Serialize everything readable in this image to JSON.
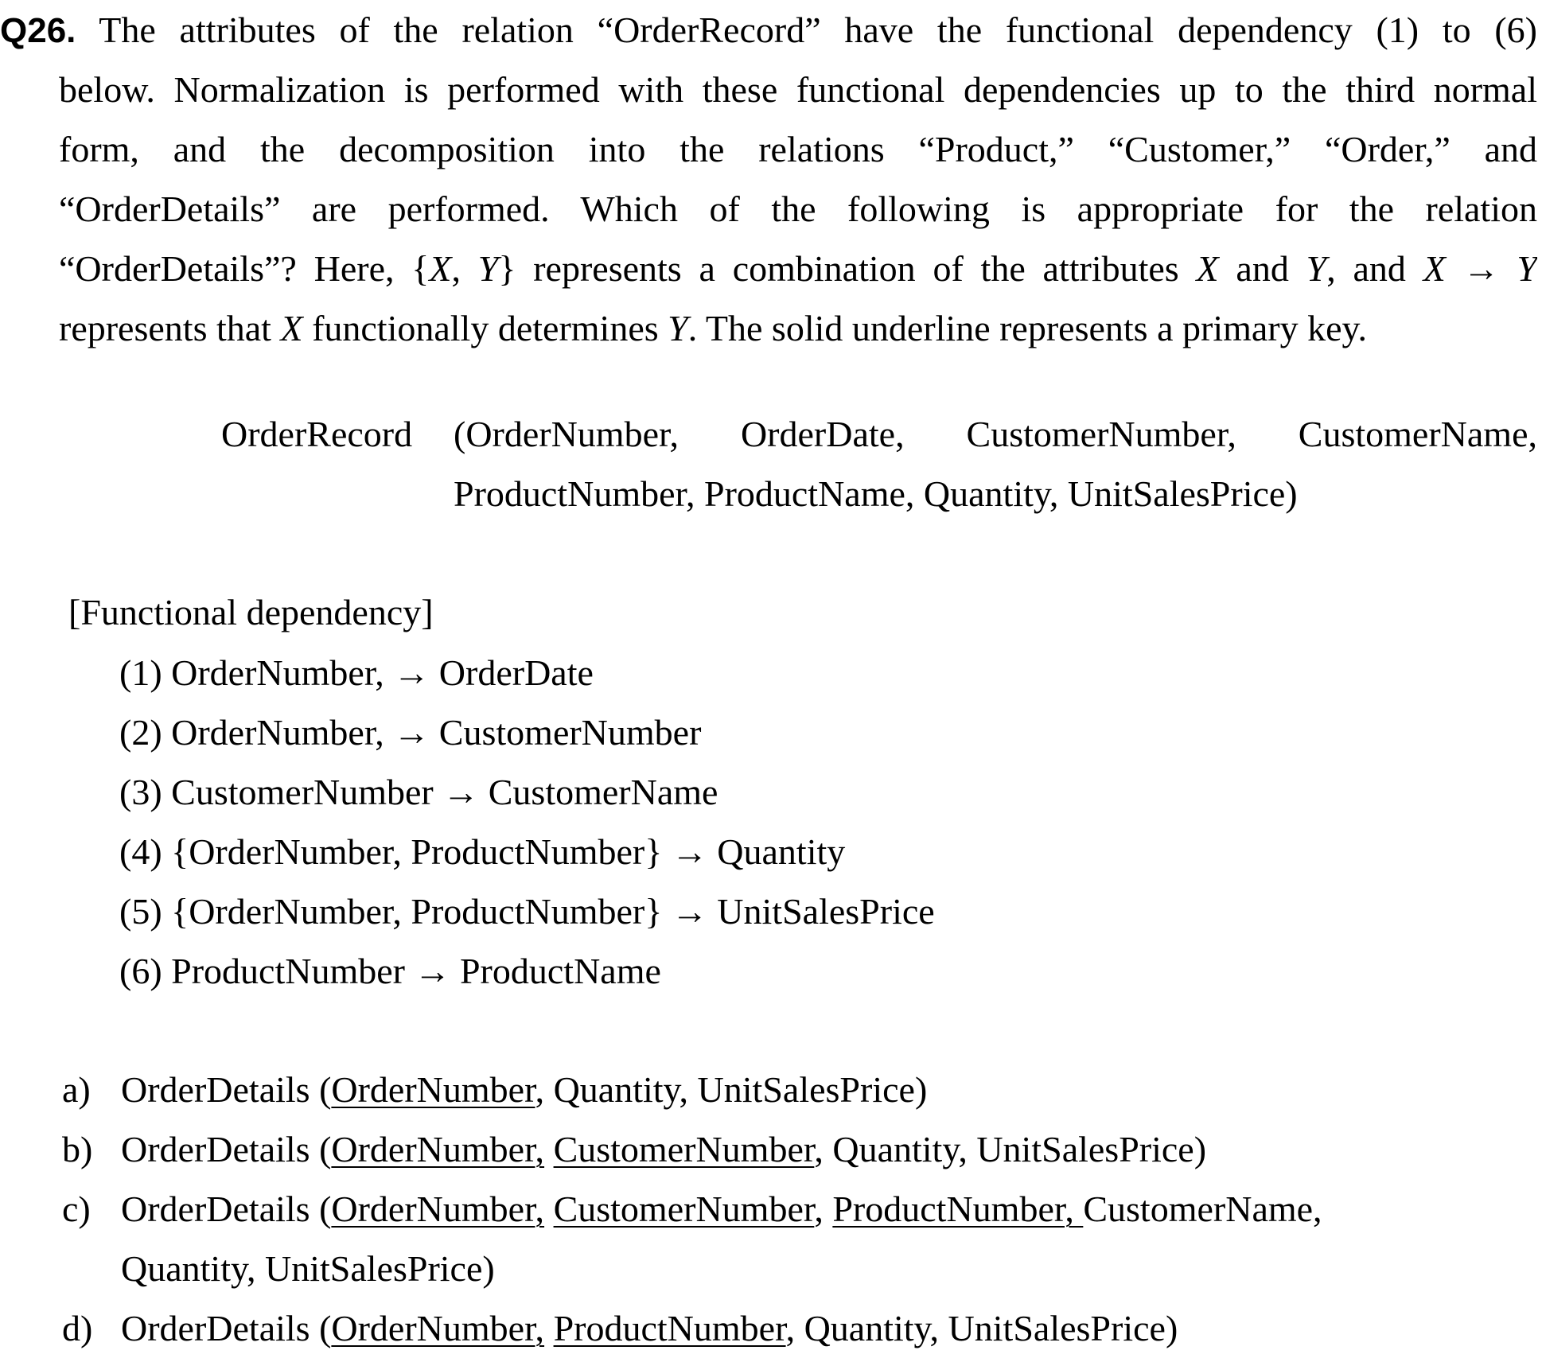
{
  "question": {
    "number": "Q26.",
    "lines": [
      " The attributes of the relation “OrderRecord” have the functional dependency (1) to (6)",
      "below. Normalization is performed with these functional dependencies up to the third normal",
      "form, and the decomposition into the relations “Product,” “Customer,” “Order,” and",
      "“OrderDetails” are performed. Which of the following is appropriate for the relation"
    ],
    "line5": {
      "a": "“OrderDetails”? Here, {",
      "x1": "X",
      "b": ", ",
      "y1": "Y",
      "c": "} represents a combination of the attributes ",
      "x2": "X",
      "d": " and ",
      "y2": "Y",
      "e": ", and ",
      "x3": "X",
      "arrow": "→",
      "y3": "Y"
    },
    "line6": {
      "a": "represents that ",
      "x": "X",
      "b": " functionally determines ",
      "y": "Y",
      "c": ". The solid underline represents a primary key."
    }
  },
  "relation": {
    "name": "OrderRecord",
    "line1": "(OrderNumber, OrderDate, CustomerNumber, CustomerName,",
    "line2": "ProductNumber, ProductName, Quantity, UnitSalesPrice)"
  },
  "fd_heading": "[Functional dependency]",
  "dependencies": [
    "(1)  OrderNumber, → OrderDate",
    "(2) OrderNumber, → CustomerNumber",
    "(3)  CustomerNumber → CustomerName",
    "(4) {OrderNumber, ProductNumber} → Quantity",
    "(5)  {OrderNumber, ProductNumber} → UnitSalesPrice",
    "(6) ProductNumber → ProductName"
  ],
  "options": {
    "a": {
      "letter": "a)",
      "pre": "OrderDetails (",
      "k1": "OrderNumber",
      "rest": ", Quantity, UnitSalesPrice)"
    },
    "b": {
      "letter": "b)",
      "pre": "OrderDetails (",
      "k1": "OrderNumber,",
      "sp1": " ",
      "k2": "CustomerNumber",
      "rest": ", Quantity, UnitSalesPrice)"
    },
    "c": {
      "letter": "c)",
      "pre": "OrderDetails (",
      "k1": "OrderNumber,",
      "sp1": " ",
      "k2": "CustomerNumber",
      "sep": ", ",
      "k3": "ProductNumber, ",
      "rest": "CustomerName,",
      "line2": "Quantity, UnitSalesPrice)"
    },
    "d": {
      "letter": "d)",
      "pre": "OrderDetails (",
      "k1": "OrderNumber,",
      "sp1": " ",
      "k2": "ProductNumber",
      "rest": ", Quantity, UnitSalesPrice)"
    }
  }
}
